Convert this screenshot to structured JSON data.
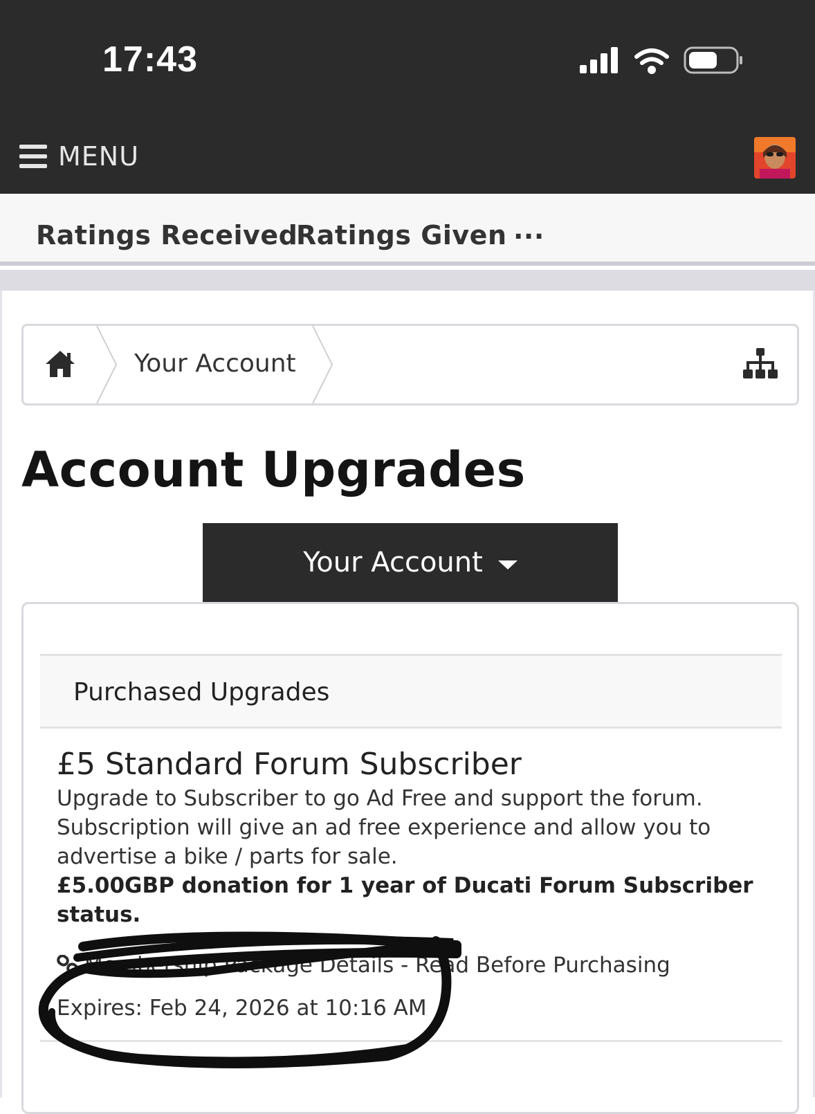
{
  "status_bar": {
    "time": "17:43"
  },
  "top_nav": {
    "menu_label": "MENU"
  },
  "tabs": [
    {
      "label": "Ratings Received"
    },
    {
      "label": "Ratings Given"
    },
    {
      "label": "..."
    }
  ],
  "breadcrumb": {
    "item": "Your Account"
  },
  "page": {
    "title": "Account Upgrades",
    "dropdown_label": "Your Account"
  },
  "purchased": {
    "heading": "Purchased Upgrades",
    "upgrade": {
      "title": "£5 Standard Forum Subscriber",
      "description": "Upgrade to Subscriber to go Ad Free and support the forum. Subscription will give an ad free experience and allow you to advertise a bike / parts for sale.",
      "price_text": "£5.00GBP donation for 1 year of Ducati Forum Subscriber status.",
      "link_label": "Membership Package Details - Read Before Purchasing",
      "expires": "Expires: Feb 24, 2026 at 10:16 AM"
    }
  },
  "colors": {
    "header_bg": "#2b2b2b",
    "tabs_bg": "#f7f7f8",
    "border": "#d9d9dd"
  }
}
